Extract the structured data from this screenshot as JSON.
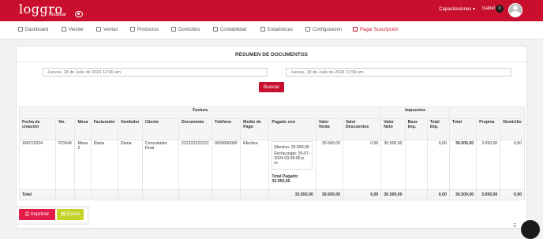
{
  "app": {
    "logo": "loggro",
    "logo_sub": "restobar"
  },
  "topbar": {
    "menu": "Capacitaciones",
    "user": "Isabel",
    "count": "0"
  },
  "nav": [
    {
      "label": "Dashboard",
      "icon": "dashboard-icon"
    },
    {
      "label": "Vender",
      "icon": "cart-icon"
    },
    {
      "label": "Ventas",
      "icon": "tag-icon"
    },
    {
      "label": "Productos",
      "icon": "box-icon"
    },
    {
      "label": "Domicilios",
      "icon": "bike-icon"
    },
    {
      "label": "Contabilidad",
      "icon": "document-icon"
    },
    {
      "label": "Estadisticas",
      "icon": "chart-icon"
    },
    {
      "label": "Configuración",
      "icon": "gear-icon"
    },
    {
      "label": "Pagar Suscripción",
      "icon": "card-icon",
      "active": true
    }
  ],
  "page": {
    "title": "RESUMEN DE DOCUMENTOS"
  },
  "filters": {
    "date_from": "Jueves, 18 de Julio de 2024 12:00 am",
    "date_to": "Jueves, 18 de Julio de 2024 11:59 pm",
    "search_label": "Buscar"
  },
  "table": {
    "group_factura": "Factura",
    "group_impuestos": "Impuestos",
    "headers": [
      "Fecha de creación",
      "No.",
      "Mesa",
      "Facturador",
      "Vendedor",
      "Cliente",
      "Documento",
      "Teléfono",
      "Medio de Pago",
      "Pagado con",
      "Valor Venta",
      "Valor Descuentos",
      "Valor Neto",
      "Base Imp.",
      "Total Imp.",
      "Total",
      "Propina",
      "Domicilio"
    ],
    "row": {
      "fecha": "18/07/2024",
      "no": "POS46",
      "mesa": "Mesa 2",
      "facturador": "Diana",
      "vendedor": "Diana",
      "cliente": "Consumidor Final",
      "documento": "222222222222",
      "telefono": "0000000000",
      "medio": "Efectivo",
      "pago_line1": "Efectivo: 33.550,00",
      "pago_line2": "Fecha pago: 25-07-2024 03:39:00 p. m.",
      "total_pagado_label": "Total Pagado:",
      "total_pagado": "33.550,00",
      "valor_venta": "30.500,00",
      "descuentos": "0,00",
      "valor_neto": "30.500,00",
      "base_imp": "",
      "total_imp": "0,00",
      "total": "30.500,00",
      "propina": "3.050,00",
      "domicilio": "0,00"
    },
    "footer": {
      "label": "Total",
      "pagado": "33.550,00",
      "valor_venta": "30.500,00",
      "descuentos": "0,00",
      "valor_neto": "30.500,00",
      "total_imp": "0,00",
      "total": "30.500,00",
      "propina": "3.050,00",
      "domicilio": "0,00"
    }
  },
  "actions": {
    "print_label": "Imprimir",
    "excel_label": "Excel"
  },
  "colors": {
    "brand": "#c8102e",
    "print": "#e11d48",
    "excel": "#c6d32a"
  }
}
